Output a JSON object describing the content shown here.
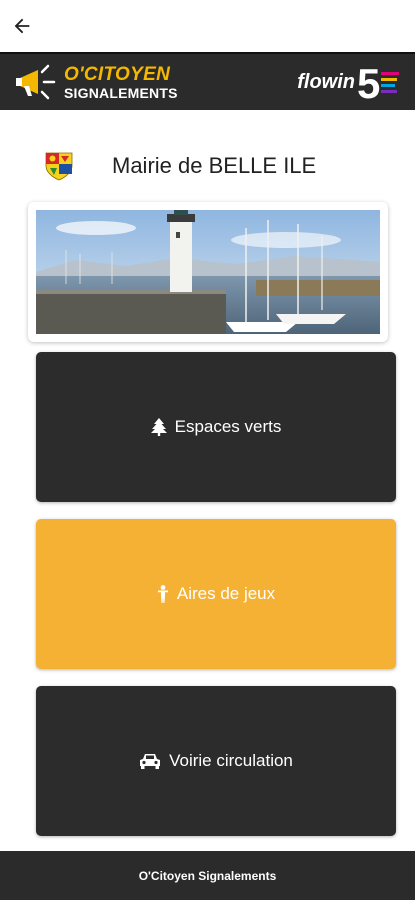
{
  "topbar": {
    "back_icon": "arrow-left-icon"
  },
  "header": {
    "brand_title": "O'CITOYEN",
    "brand_subtitle": "SIGNALEMENTS",
    "brand_icon": "megaphone-icon",
    "partner_text": "flowin",
    "partner_digit": "5",
    "accent": "#f5b800",
    "background": "#2b2b2b"
  },
  "mairie": {
    "title": "Mairie de BELLE ILE",
    "crest_icon": "coat-of-arms-icon"
  },
  "photo": {
    "subject": "lighthouse-harbor-image"
  },
  "tiles": [
    {
      "label": "Espaces verts",
      "icon": "tree-icon",
      "color": "#2c2c2c"
    },
    {
      "label": "Aires de jeux",
      "icon": "child-icon",
      "color": "#f5b133"
    },
    {
      "label": "Voirie circulation",
      "icon": "car-icon",
      "color": "#2c2c2c"
    }
  ],
  "footer": {
    "text": "O'Citoyen Signalements"
  }
}
